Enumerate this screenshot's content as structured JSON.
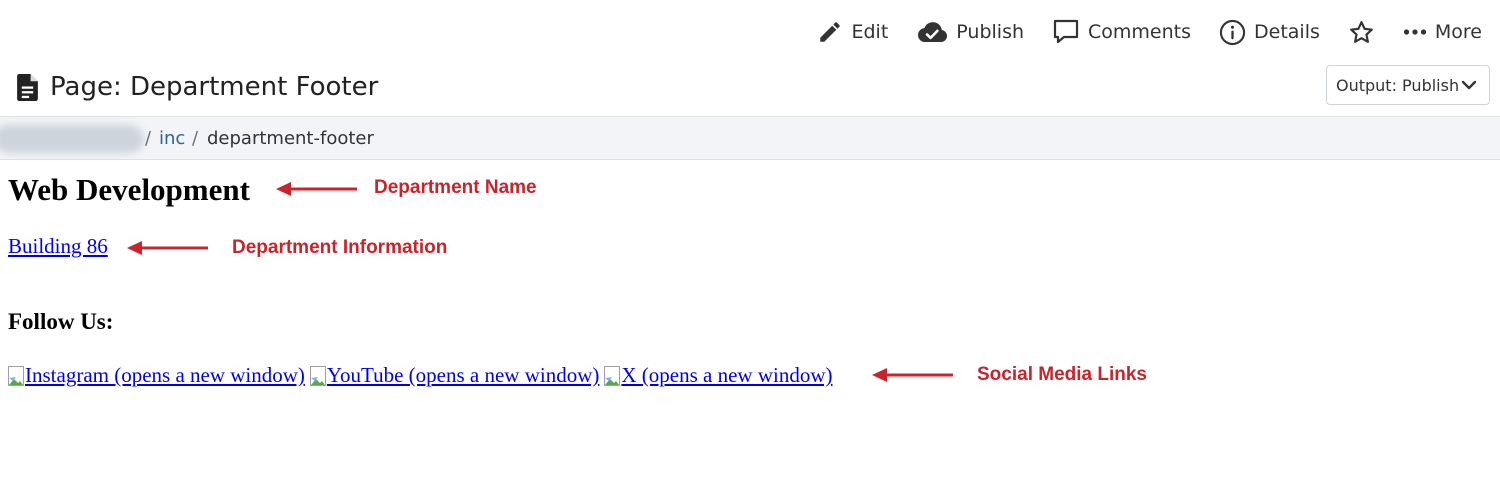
{
  "toolbar": {
    "items": [
      {
        "label": "Edit",
        "icon": "pencil-icon"
      },
      {
        "label": "Publish",
        "icon": "cloud-check-icon"
      },
      {
        "label": "Comments",
        "icon": "comment-bubble-icon"
      },
      {
        "label": "Details",
        "icon": "info-circle-icon"
      },
      {
        "label": "",
        "icon": "star-icon"
      },
      {
        "label": "More",
        "icon": "ellipsis-icon"
      }
    ]
  },
  "header": {
    "title": "Page: Department Footer",
    "icon": "document-icon",
    "output_select": "Output: Publish"
  },
  "breadcrumb": {
    "hidden_segment": "redacted",
    "separator": "/",
    "link": "inc",
    "current": "department-footer"
  },
  "content": {
    "department_name": "Web Development",
    "department_info": "Building 86",
    "follow_heading": "Follow Us:",
    "social_links": [
      "Instagram (opens a new window)",
      "YouTube (opens a new window)",
      "X (opens a new window)"
    ]
  },
  "annotations": {
    "department_name": "Department Name",
    "department_info": "Department Information",
    "social_media": "Social Media Links"
  },
  "colors": {
    "annotation_red": "#c8242b",
    "link_blue": "#0000ee",
    "breadcrumb_link": "#2a6496",
    "breadcrumb_bg": "#f2f4f7"
  }
}
